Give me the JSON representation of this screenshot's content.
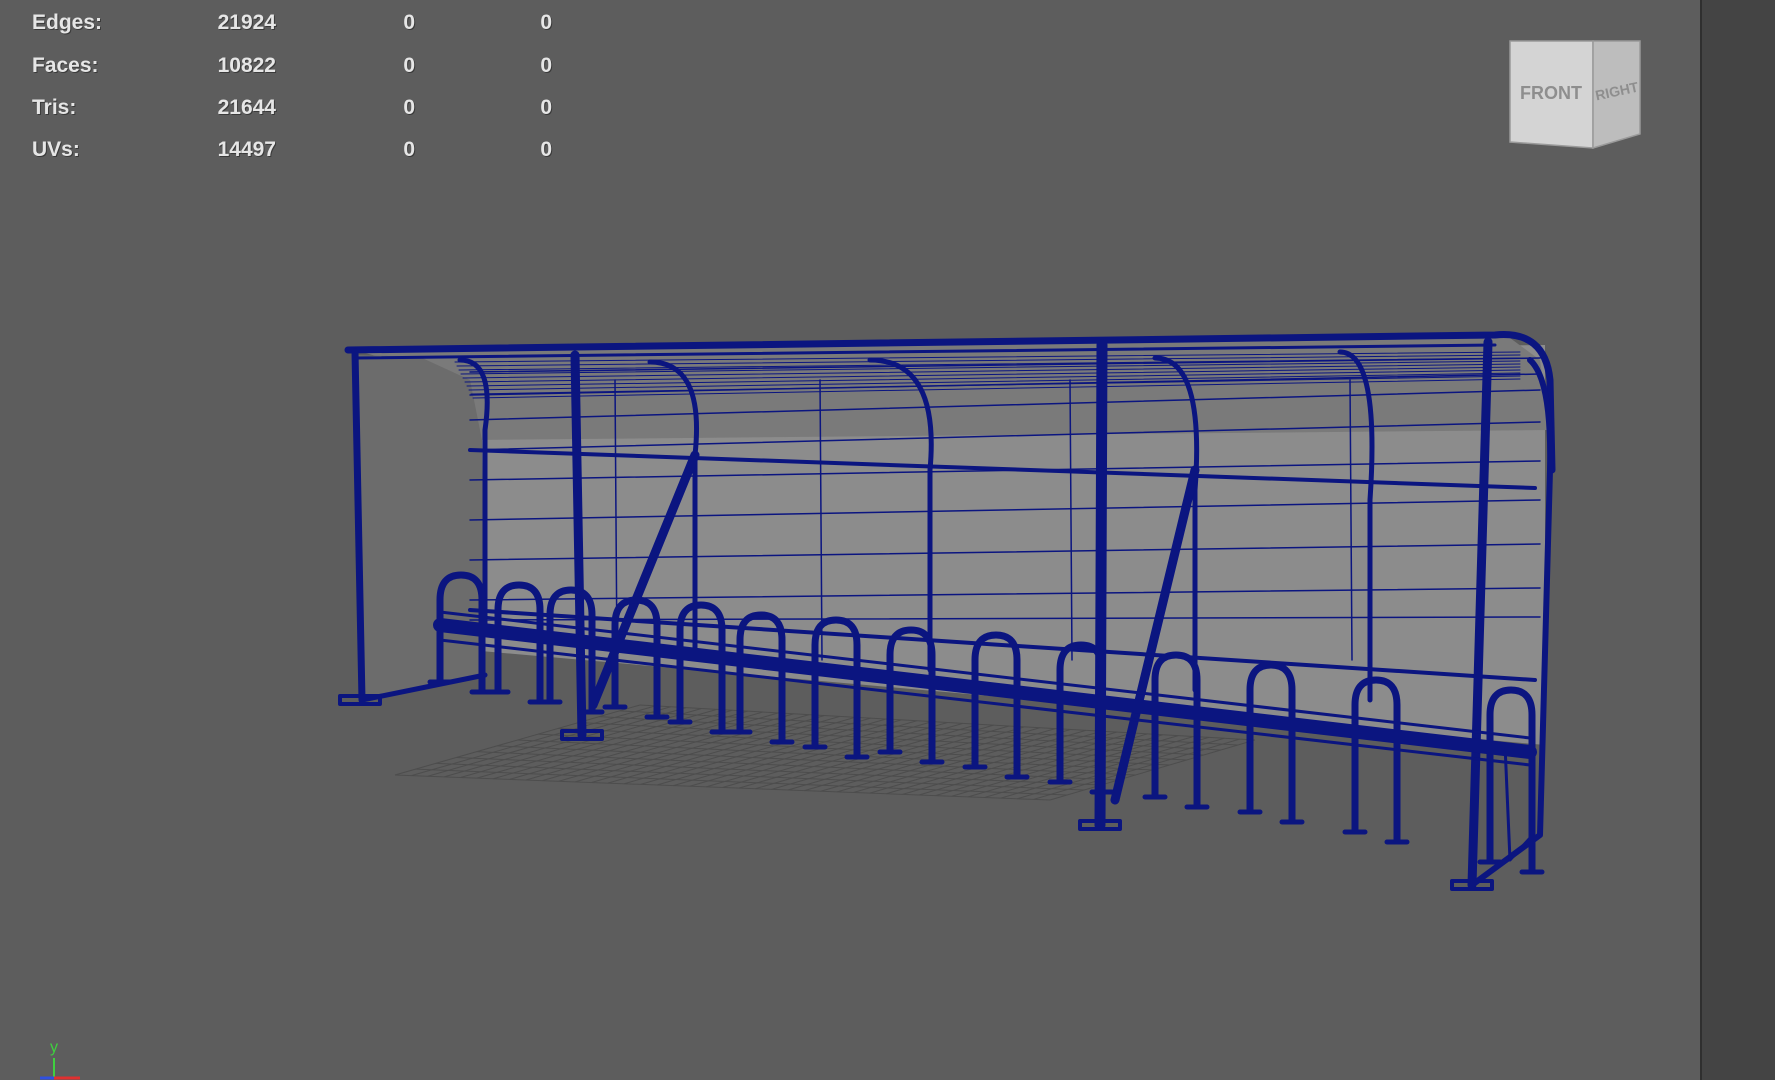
{
  "hud": {
    "rows": [
      {
        "label": "Edges:",
        "value": "21924",
        "sel": "0",
        "uv": "0"
      },
      {
        "label": "Faces:",
        "value": "10822",
        "sel": "0",
        "uv": "0"
      },
      {
        "label": "Tris:",
        "value": "21644",
        "sel": "0",
        "uv": "0"
      },
      {
        "label": "UVs:",
        "value": "14497",
        "sel": "0",
        "uv": "0"
      }
    ]
  },
  "viewcube": {
    "front_label": "FRONT",
    "right_label": "RIGHT"
  },
  "axis": {
    "y_label": "y"
  },
  "colors": {
    "viewport_bg": "#5d5d5d",
    "wireframe": "#0b1580",
    "panel": "#8a8a8a",
    "grid": "#4a4a4a",
    "axis_y": "#3fd03f",
    "axis_x": "#e03030",
    "axis_z": "#3050e0"
  }
}
